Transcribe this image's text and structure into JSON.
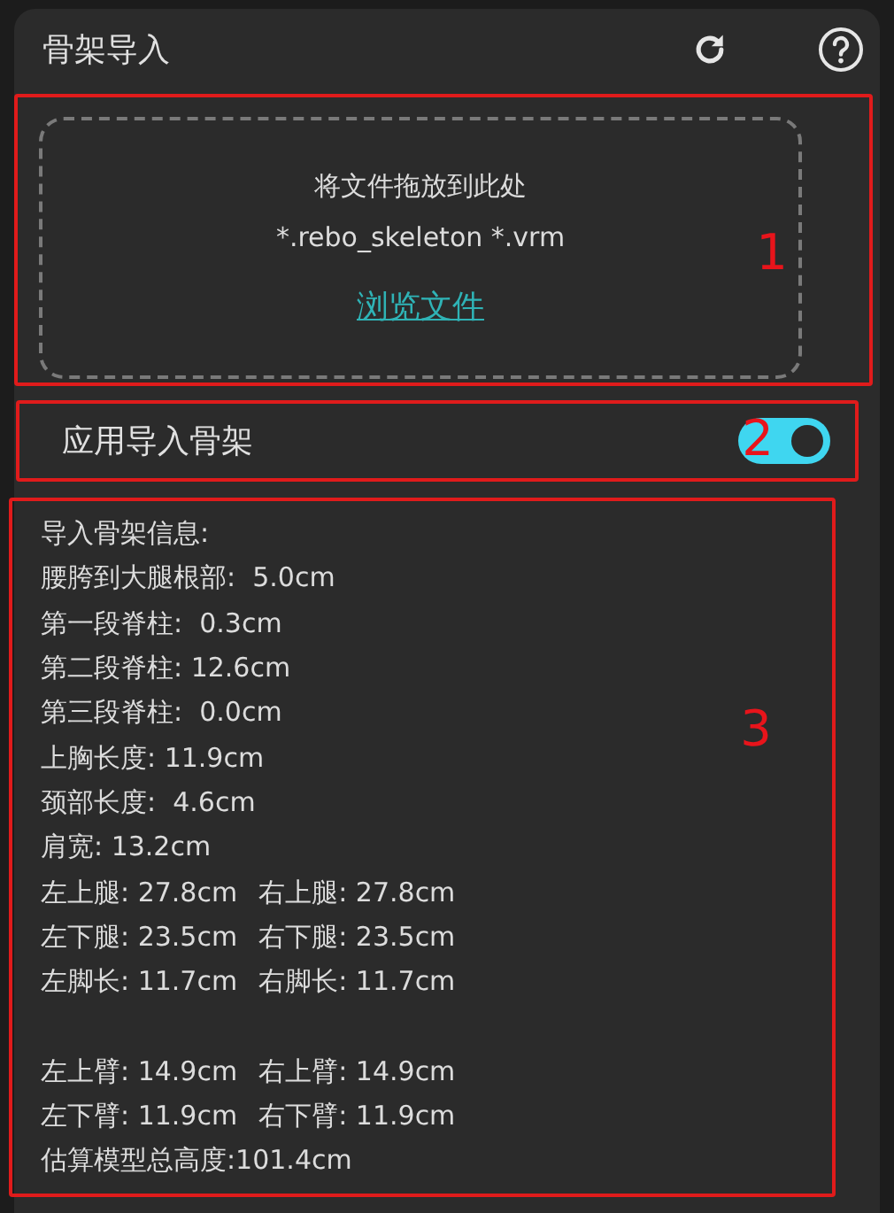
{
  "panel": {
    "title": "骨架导入"
  },
  "drop_zone": {
    "callout": "1",
    "prompt": "将文件拖放到此处",
    "formats": "*.rebo_skeleton *.vrm",
    "link": "浏览文件"
  },
  "apply_toggle": {
    "callout": "2",
    "label": "应用导入骨架",
    "on": true
  },
  "info": {
    "callout": "3",
    "lines": [
      {
        "kind": "text",
        "parts": [
          "导入骨架信息:"
        ]
      },
      {
        "kind": "text",
        "parts": [
          "腰胯到大腿根部:  5.0cm"
        ]
      },
      {
        "kind": "text",
        "parts": [
          "第一段脊柱:  0.3cm"
        ]
      },
      {
        "kind": "text",
        "parts": [
          "第二段脊柱: 12.6cm"
        ]
      },
      {
        "kind": "text",
        "parts": [
          "第三段脊柱:  0.0cm"
        ]
      },
      {
        "kind": "text",
        "parts": [
          "上胸长度: 11.9cm"
        ]
      },
      {
        "kind": "text",
        "parts": [
          "颈部长度:  4.6cm"
        ]
      },
      {
        "kind": "text",
        "parts": [
          "肩宽: 13.2cm"
        ]
      },
      {
        "kind": "text",
        "parts": [
          "左上腿: 27.8cm",
          "右上腿: 27.8cm"
        ]
      },
      {
        "kind": "text",
        "parts": [
          "左下腿: 23.5cm",
          "右下腿: 23.5cm"
        ]
      },
      {
        "kind": "text",
        "parts": [
          "左脚长: 11.7cm",
          "右脚长: 11.7cm"
        ]
      },
      {
        "kind": "spacer"
      },
      {
        "kind": "text",
        "parts": [
          "左上臂: 14.9cm",
          "右上臂: 14.9cm"
        ]
      },
      {
        "kind": "text",
        "parts": [
          "左下臂: 11.9cm",
          "右下臂: 11.9cm"
        ]
      },
      {
        "kind": "text",
        "parts": [
          "估算模型总高度:101.4cm"
        ]
      }
    ]
  }
}
